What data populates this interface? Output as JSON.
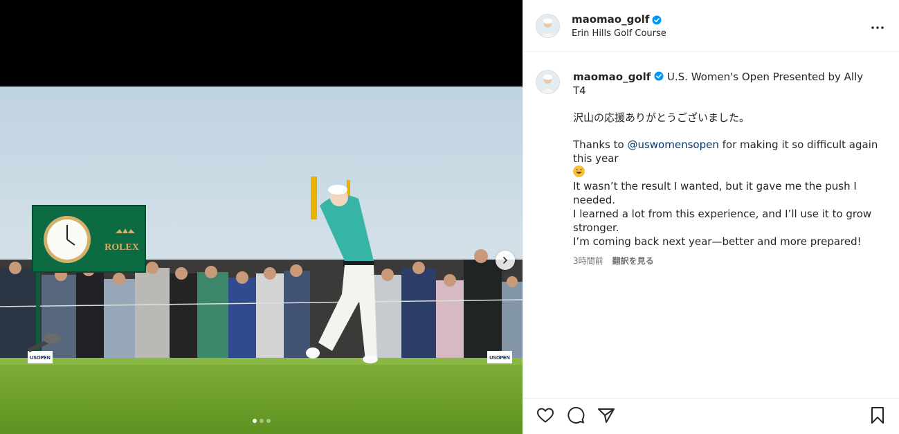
{
  "header": {
    "username": "maomao_golf",
    "location": "Erin Hills Golf Course",
    "verified_icon": "verified-badge-icon",
    "more_icon": "more-options-icon"
  },
  "caption": {
    "username": "maomao_golf",
    "title": "U.S. Women's Open Presented by Ally",
    "line_t4": "T4",
    "line_jp": "沢山の応援ありがとうございました。",
    "thanks_prefix": "Thanks to ",
    "mention": "@uswomensopen",
    "thanks_suffix": " for making it so difficult again this year",
    "emoji": "grinning-sweat-emoji",
    "line_result": "It wasn’t the result I wanted, but it gave me the push I needed.",
    "line_learned": "I learned a lot from this experience, and I’ll use it to grow stronger.",
    "line_coming": "I’m coming back next year—better and more prepared!",
    "time": "3時間前",
    "translate": "翻訳を見る"
  },
  "media": {
    "sign_brand": "ROLEX",
    "usopen_left": "USOPEN",
    "usopen_right": "USOPEN",
    "carousel": {
      "count": 3,
      "active": 1
    },
    "next_icon": "chevron-right-icon"
  },
  "actions": {
    "like_icon": "heart-icon",
    "comment_icon": "comment-bubble-icon",
    "share_icon": "paper-plane-icon",
    "save_icon": "bookmark-icon"
  },
  "colors": {
    "verified": "#0095f6",
    "mention": "#00376b",
    "secondary_text": "#737373",
    "divider": "#efefef"
  }
}
